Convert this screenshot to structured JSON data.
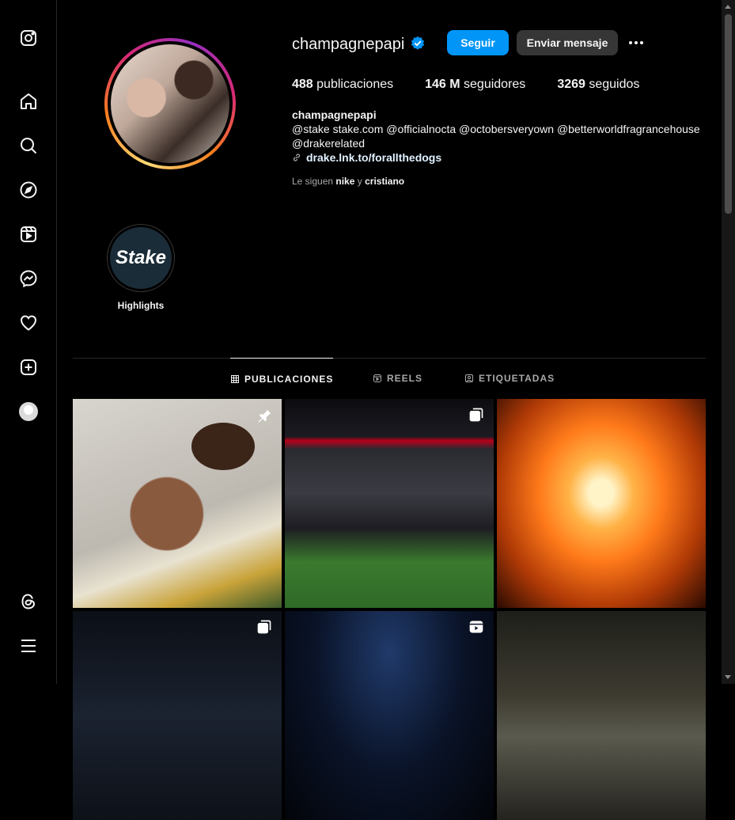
{
  "sidebar": {
    "items": [
      {
        "name": "instagram-logo-icon"
      },
      {
        "name": "home-icon"
      },
      {
        "name": "search-icon"
      },
      {
        "name": "explore-icon"
      },
      {
        "name": "reels-icon"
      },
      {
        "name": "messenger-icon"
      },
      {
        "name": "heart-icon"
      },
      {
        "name": "create-icon"
      },
      {
        "name": "profile-avatar"
      },
      {
        "name": "threads-icon"
      },
      {
        "name": "menu-icon"
      }
    ]
  },
  "profile": {
    "username": "champagnepapi",
    "verified": true,
    "follow_label": "Seguir",
    "message_label": "Enviar mensaje",
    "stats": {
      "posts_count": "488",
      "posts_label": "publicaciones",
      "followers_count": "146 M",
      "followers_label": "seguidores",
      "following_count": "3269",
      "following_label": "seguidos"
    },
    "bio_name": "champagnepapi",
    "bio_line1": "@stake stake.com @officialnocta @octobersveryown @betterworldfragrancehouse",
    "bio_line2": "@drakerelated",
    "link": "drake.lnk.to/forallthedogs",
    "followed_by_prefix": "Le siguen",
    "followed_by_1": "nike",
    "followed_by_and": "y",
    "followed_by_2": "cristiano"
  },
  "highlights": [
    {
      "label": "Highlights",
      "cover_text": "Stake"
    }
  ],
  "tabs": [
    {
      "label": "PUBLICACIONES",
      "active": true
    },
    {
      "label": "REELS",
      "active": false
    },
    {
      "label": "ETIQUETADAS",
      "active": false
    }
  ],
  "posts": [
    {
      "type": "pinned",
      "icon": "pin-icon"
    },
    {
      "type": "carousel",
      "icon": "carousel-icon"
    },
    {
      "type": "image",
      "icon": ""
    },
    {
      "type": "carousel",
      "icon": "carousel-icon"
    },
    {
      "type": "reel",
      "icon": "reel-icon"
    },
    {
      "type": "image",
      "icon": ""
    }
  ],
  "colors": {
    "accent": "#0095f6",
    "background": "#000000",
    "secondary_button": "#363636",
    "verified": "#0095f6"
  }
}
